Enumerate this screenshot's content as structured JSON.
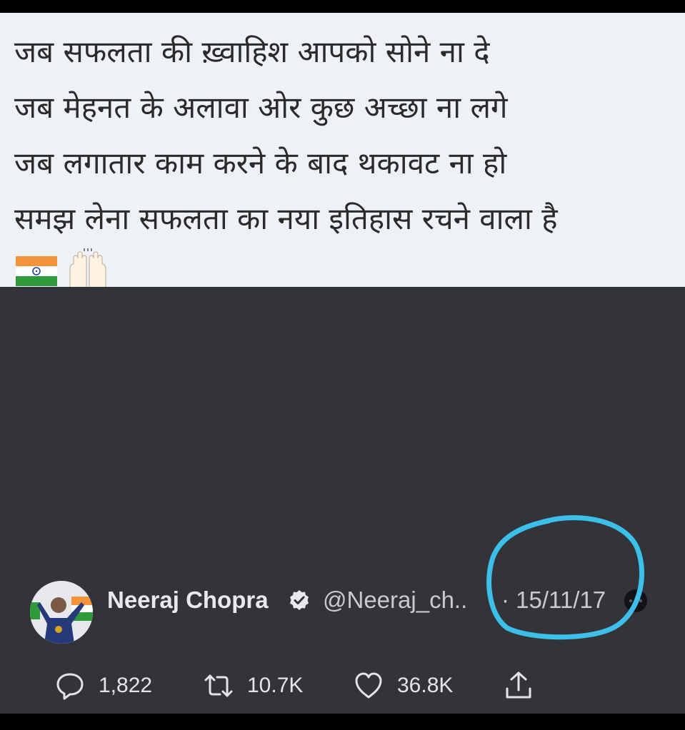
{
  "tweet": {
    "lines": [
      "जब सफलता की ख़्वाहिश आपको सोने ना दे",
      "जब मेहनत के अलावा ओर कुछ अच्छा ना लगे",
      "जब लगातार काम करने के बाद थकावट ना हो",
      "समझ लेना सफलता का नया इतिहास रचने वाला है"
    ],
    "emojis": [
      "flag-india-icon",
      "raising-hands-icon"
    ]
  },
  "author": {
    "name": "Neeraj Chopra",
    "handle": "@Neeraj_ch..",
    "date": "· 15/11/17",
    "verified": true
  },
  "stats": {
    "replies": "1,822",
    "retweets": "10.7K",
    "likes": "36.8K"
  },
  "colors": {
    "text_panel_bg": "#eef1f5",
    "dark_panel_bg": "#33343a",
    "annotation_stroke": "#3cc0ea"
  }
}
